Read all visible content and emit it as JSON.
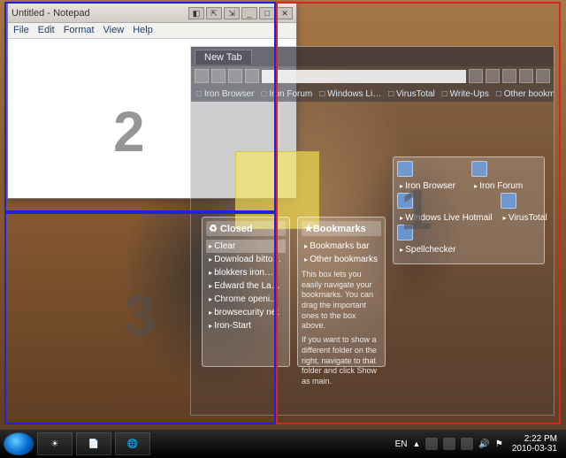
{
  "notepad": {
    "title": "Untitled - Notepad",
    "menu": {
      "file": "File",
      "edit": "Edit",
      "format": "Format",
      "view": "View",
      "help": "Help"
    }
  },
  "browser": {
    "tab": "New Tab",
    "bookmarks_bar": {
      "b0": "Iron Browser",
      "b1": "Iron Forum",
      "b2": "Windows Li…",
      "b3": "VirusTotal",
      "b4": "Write-Ups",
      "b5": "Other bookma…"
    },
    "closed": {
      "title": "♻ Closed",
      "clear": "Clear",
      "i0": "Download bitton…",
      "i1": "blokkers iron…",
      "i2": "Edward the Las…",
      "i3": "Chrome opening…",
      "i4": "browsecurity net",
      "i5": "Iron-Start"
    },
    "bookmarks_panel": {
      "title": "★Bookmarks",
      "i0": "Bookmarks bar",
      "i1": "Other bookmarks",
      "hint1": "This box lets you easily navigate your bookmarks. You can drag the important ones to the box above.",
      "hint2": "If you want to show a different folder on the right, navigate to that folder and click Show as main."
    },
    "apps": {
      "a0": "Iron Browser",
      "a1": "Iron Forum",
      "a2": "Windows Live Hotmail",
      "a3": "VirusTotal",
      "a4": "Spellchecker"
    }
  },
  "taskbar": {
    "lang": "EN",
    "time": "2:22 PM",
    "date": "2010-03-31"
  },
  "overlay": {
    "n1": "1",
    "n2": "2",
    "n3": "3"
  }
}
